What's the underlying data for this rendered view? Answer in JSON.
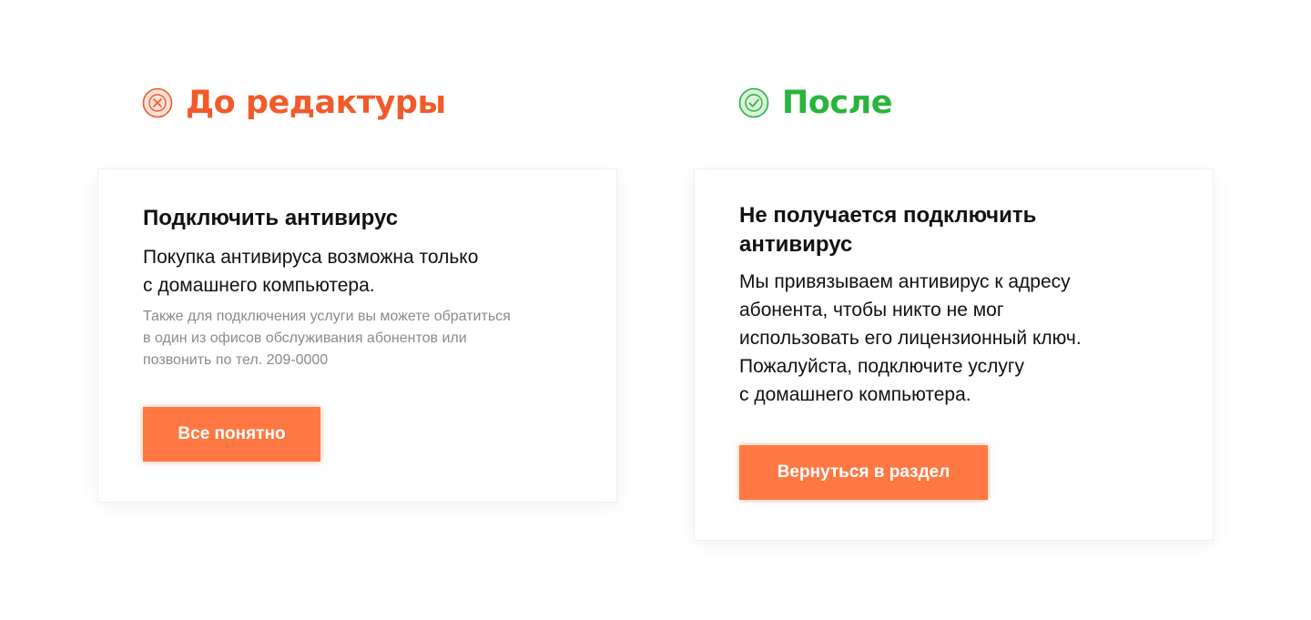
{
  "before": {
    "heading": "До редактуры",
    "icon": "x-circle-icon",
    "accent_color": "#f25a2a",
    "card": {
      "title": "Подключить антивирус",
      "body": "Покупка антивируса возможна только\nс домашнего компьютера.",
      "note": "Также для подключения услуги вы можете обратиться\nв один из офисов обслуживания абонентов или\nпозвонить по тел. 209-0000",
      "button_label": "Все понятно"
    }
  },
  "after": {
    "heading": "После",
    "icon": "check-circle-icon",
    "accent_color": "#29b43b",
    "card": {
      "title": "Не получается подключить антивирус",
      "body": "Мы привязываем антивирус к адресу\nабонента, чтобы никто не мог\nиспользовать его лицензионный ключ.\nПожалуйста, подключите услугу\nс домашнего компьютера.",
      "button_label": "Вернуться в раздел"
    }
  },
  "button_color": "#ff7843"
}
